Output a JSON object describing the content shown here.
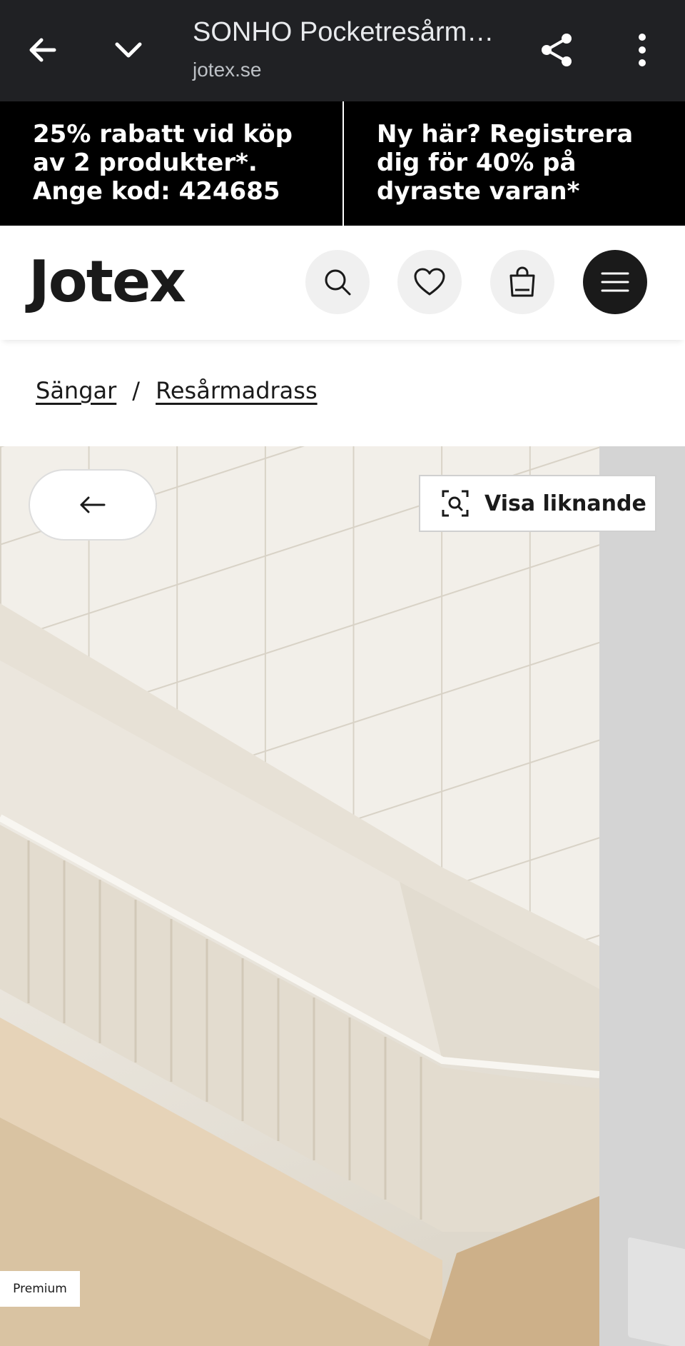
{
  "browser": {
    "title": "SONHO Pocketresårm…",
    "url": "jotex.se"
  },
  "promo": [
    {
      "text": "25% rabatt vid köp av 2 produkter*. Ange kod: 424685"
    },
    {
      "text": "Ny här? Registrera dig för 40% på dyraste varan*"
    }
  ],
  "header": {
    "logo": "Jotex",
    "icons": [
      "search-icon",
      "heart-icon",
      "bag-icon",
      "menu-icon"
    ]
  },
  "breadcrumb": {
    "items": [
      "Sängar",
      "Resårmadrass"
    ],
    "separator": "/"
  },
  "gallery": {
    "similar_label": "Visa liknande",
    "badge": "Premium"
  },
  "colors": {
    "browser_bar": "#202124",
    "promo_bg": "#000000",
    "menu_button": "#1a1a1a",
    "icon_button_bg": "#f0f0f0"
  }
}
